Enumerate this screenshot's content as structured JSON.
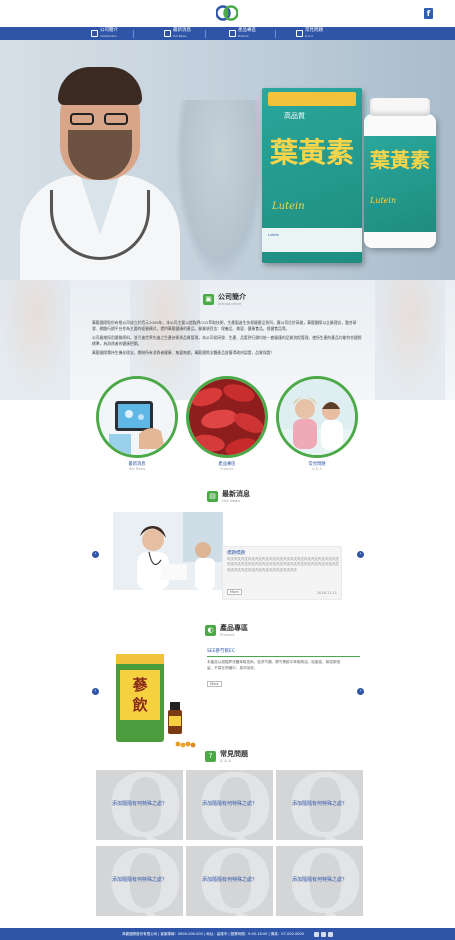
{
  "brand": {
    "logo_icon": "cross-circle-logo",
    "facebook_icon": "facebook-icon",
    "facebook_label": "f"
  },
  "nav": [
    {
      "zh": "公司簡介",
      "en": "Introduction",
      "icon": "building-icon"
    },
    {
      "zh": "最新消息",
      "en": "Hot News",
      "icon": "news-icon"
    },
    {
      "zh": "產品專區",
      "en": "Product",
      "icon": "product-icon"
    },
    {
      "zh": "常見問題",
      "en": "Q & A",
      "icon": "question-icon"
    }
  ],
  "hero": {
    "box_top": "高品質",
    "box_sub": "高品\n質精\n選",
    "box_title": "葉黃素",
    "box_en": "Lutein",
    "box_stripe": "Lutein",
    "bottle_title": "葉黃素",
    "bottle_en": "Lutein",
    "slides": 2,
    "active_slide": 1
  },
  "intro": {
    "title": "公司簡介",
    "subtitle": "Introduction",
    "paragraphs": [
      "萬龍國際股份有限公司成立於西元2009年，本公司主要以超臨界CO2萃取技術，生產製造生技保健產品系列，廣公司位於高雄，萬龍國際以企業理念，整合研發、網路行銷平台作為主要的經營模式，提供萬龍健康的產品，營業項目含：保養品、美容、健康食品，保健食品等。",
      "公司嚴格採用優質原料，並引進世界先進之生產技術與品質管理，本公司從研發、生產、品管到行銷均依一套嚴謹的品質流程管理，使所生產的產品均能符合國際標準，為消費者的健康把關。",
      "萬龍國際秉持生機化理念，期盼所有消費者健康、無憂無慮，萬龍國際全體產品皆獲得政府認證，品質保證！"
    ]
  },
  "features": [
    {
      "zh": "最新消息",
      "en": "Hot News"
    },
    {
      "zh": "產品專區",
      "en": "Product"
    },
    {
      "zh": "常見問題",
      "en": "Q & A"
    }
  ],
  "news": {
    "title": "最新消息",
    "subtitle": "Hot News",
    "card_title": "標題標題",
    "card_body": "內文內文內文內文內文內文內文內文內文內文內文內文內文內文內文內文內文內文內文內文內文內文內文內文內文內文內文內文內文內文內文內文內文內文內文內文內文內文內文內文內文內文",
    "more": "More",
    "date": "2016.11.11"
  },
  "product": {
    "title": "產品專區",
    "subtitle": "Product",
    "name": "SEE蔘芍飲EC",
    "desc": "本產品以超臨界流體萃取技術，從蔘芍類、蕨芍黃飲中萃取精油，純度高，無溶劑殘留，不易在肝臟中，易可吸收。",
    "more": "More",
    "can_text": "蔘飲"
  },
  "qa": {
    "title": "常見問題",
    "subtitle": "Q & A",
    "cards": [
      "添加隨隨有何特殊之處？",
      "添加隨隨有何特殊之處？",
      "添加隨隨有何特殊之處？",
      "添加隨隨有何特殊之處？",
      "添加隨隨有何特殊之處？",
      "添加隨隨有何特殊之處？"
    ]
  },
  "footer": {
    "text": "萬龍國際股份有限公司  |  客服專線：0800-000-000  |  地址：高雄市  |  營業時間：9:00-18:00  |  傳真：07-000-0000"
  },
  "colors": {
    "primary": "#2e55a8",
    "green": "#4ba947",
    "gold": "#f6d54a",
    "teal": "#1f8c80"
  }
}
